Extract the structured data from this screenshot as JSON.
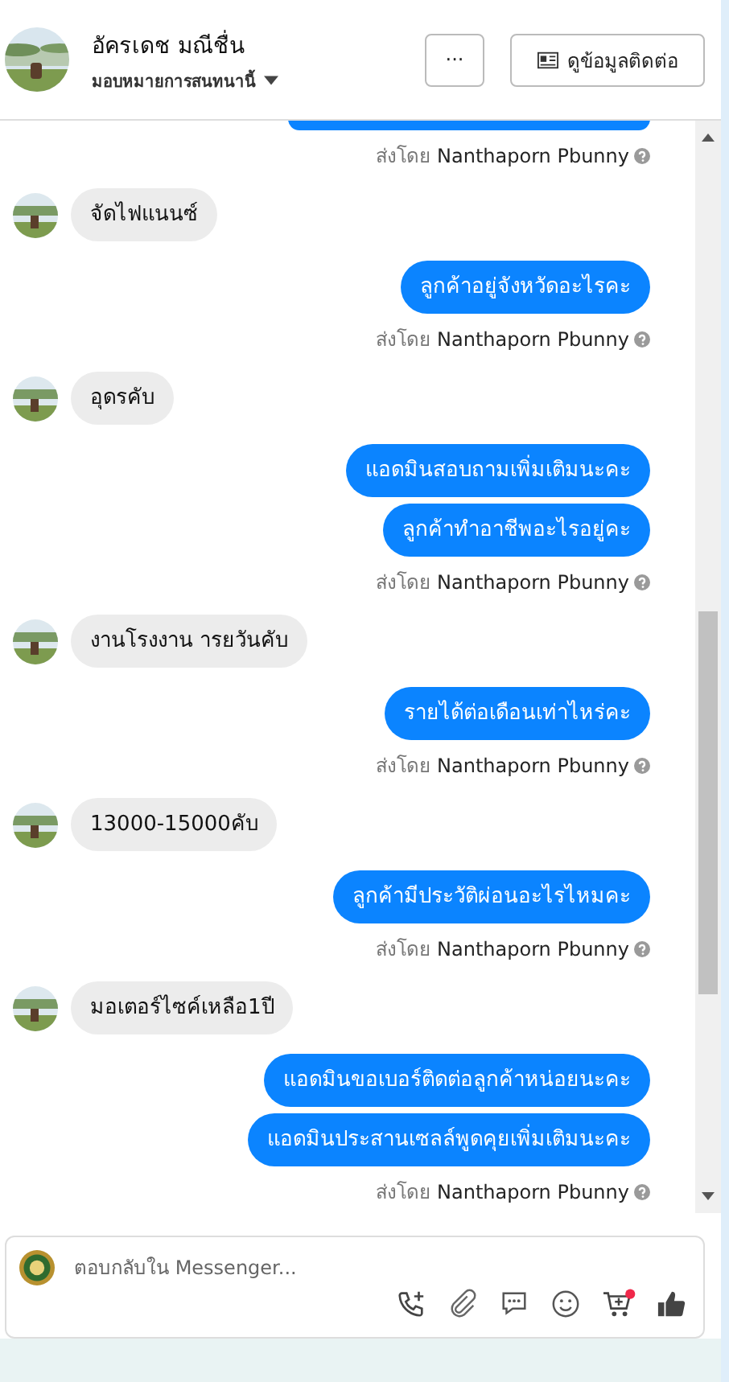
{
  "header": {
    "name": "อัครเดช มณีชื่น",
    "subtitle": "มอบหมายการสนทนานี้",
    "more_button": "···",
    "contact_button": "ดูข้อมูลติดต่อ"
  },
  "messages": [
    {
      "kind": "sent_tail",
      "sender_prefix": "ส่งโดย",
      "sender": "Nanthaporn Pbunny"
    },
    {
      "kind": "received",
      "texts": [
        "จัดไฟแนนซ์"
      ]
    },
    {
      "kind": "sent",
      "texts": [
        "ลูกค้าอยู่จังหวัดอะไรคะ"
      ],
      "sender_prefix": "ส่งโดย",
      "sender": "Nanthaporn Pbunny"
    },
    {
      "kind": "received",
      "texts": [
        "อุดรคับ"
      ]
    },
    {
      "kind": "sent",
      "texts": [
        "แอดมินสอบถามเพิ่มเติมนะคะ",
        "ลูกค้าทำอาชีพอะไรอยู่คะ"
      ],
      "sender_prefix": "ส่งโดย",
      "sender": "Nanthaporn Pbunny"
    },
    {
      "kind": "received",
      "texts": [
        "งานโรงงาน ารยวันคับ"
      ]
    },
    {
      "kind": "sent",
      "texts": [
        "รายได้ต่อเดือนเท่าไหร่คะ"
      ],
      "sender_prefix": "ส่งโดย",
      "sender": "Nanthaporn Pbunny"
    },
    {
      "kind": "received",
      "texts": [
        "13000-15000คับ"
      ]
    },
    {
      "kind": "sent",
      "texts": [
        "ลูกค้ามีประวัติผ่อนอะไรไหมคะ"
      ],
      "sender_prefix": "ส่งโดย",
      "sender": "Nanthaporn Pbunny"
    },
    {
      "kind": "received",
      "texts": [
        "มอเตอร์ไซค์เหลือ1ปี"
      ]
    },
    {
      "kind": "sent",
      "texts": [
        "แอดมินขอเบอร์ติดต่อลูกค้าหน่อยนะคะ",
        "แอดมินประสานเซลล์พูดคุยเพิ่มเติมนะคะ"
      ],
      "sender_prefix": "ส่งโดย",
      "sender": "Nanthaporn Pbunny"
    }
  ],
  "composer": {
    "placeholder": "ตอบกลับใน Messenger...",
    "cart_badge": true
  }
}
